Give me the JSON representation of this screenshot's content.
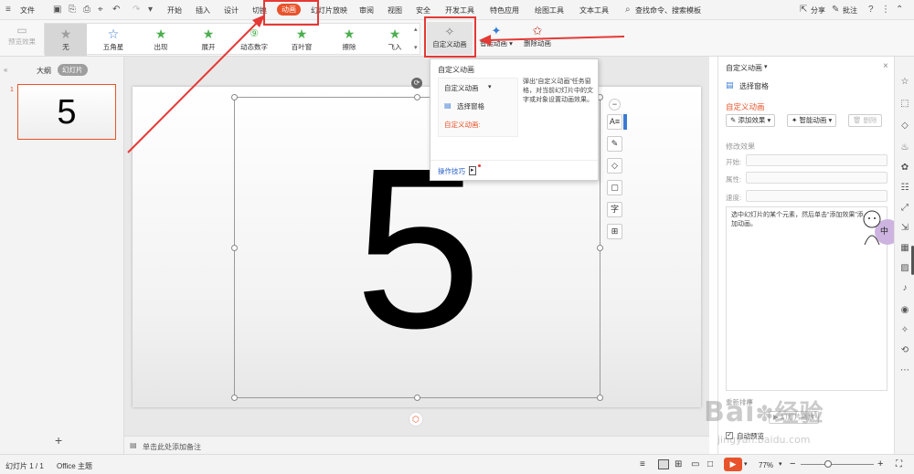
{
  "menubar": {
    "file": "文件",
    "tabs": [
      "开始",
      "插入",
      "设计",
      "切换",
      "动画",
      "幻灯片放映",
      "审阅",
      "视图",
      "安全",
      "开发工具",
      "特色应用",
      "绘图工具",
      "文本工具"
    ],
    "search": "查找命令、搜索模板",
    "share": "分享",
    "comment": "批注"
  },
  "ribbon": {
    "preview": "预览效果",
    "animations": [
      {
        "label": "无",
        "icon": "star-icon"
      },
      {
        "label": "五角星",
        "icon": "star-outline-icon"
      },
      {
        "label": "出现",
        "icon": "star-icon"
      },
      {
        "label": "展开",
        "icon": "star-icon"
      },
      {
        "label": "动态数字",
        "icon": "number-icon"
      },
      {
        "label": "百叶窗",
        "icon": "star-icon"
      },
      {
        "label": "擦除",
        "icon": "star-icon"
      },
      {
        "label": "飞入",
        "icon": "star-icon"
      }
    ],
    "custom": "自定义动画",
    "smart": "智能动画",
    "delete": "删除动画"
  },
  "leftpanel": {
    "outline": "大纲",
    "slides": "幻灯片",
    "thumb_number": "1",
    "thumb_text": "5"
  },
  "slide": {
    "big_text": "5"
  },
  "notes": "单击此处添加备注",
  "popup": {
    "title": "自定义动画",
    "mini_title": "自定义动画",
    "mini_select": "选择窗格",
    "mini_custom": "自定义动画:",
    "description": "弹出“自定义动画”任务窗格，对当前幻灯片中的文字或对象设置动画效果。",
    "tips": "操作技巧"
  },
  "rightpanel": {
    "header": "自定义动画",
    "select_pane": "选择窗格",
    "section": "自定义动画",
    "add_effect": "添加效果",
    "smart_anim": "智能动画",
    "delete": "删除",
    "modify": "修改效果",
    "start": "开始:",
    "property": "属性:",
    "speed": "速度:",
    "hint": "选中幻灯片的某个元素，然后单击“添加效果”添加动画。",
    "reorder": "重新排序",
    "play": "幻灯片播放",
    "autopreview": "自动预览",
    "avatar_text": "中"
  },
  "statusbar": {
    "slide_count": "幻灯片 1 / 1",
    "theme": "Office 主题",
    "zoom": "77%"
  },
  "watermark": {
    "logo": "Bai",
    "logo2": "经验",
    "url": "jingyan.baidu.com"
  },
  "colors": {
    "accent": "#e8532b",
    "highlight_red": "#e53935",
    "star_green": "#4caf50",
    "link_blue": "#2a62c9"
  }
}
